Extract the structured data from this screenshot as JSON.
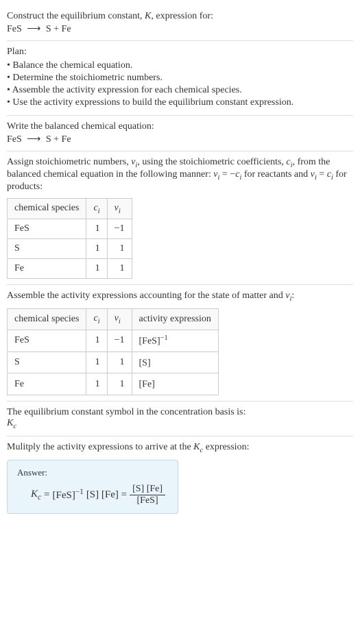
{
  "intro": {
    "prompt": "Construct the equilibrium constant, ",
    "k_symbol": "K",
    "prompt_suffix": ", expression for:",
    "equation_left": "FeS",
    "arrow": "⟶",
    "equation_right": "S + Fe"
  },
  "plan": {
    "label": "Plan:",
    "items": [
      "Balance the chemical equation.",
      "Determine the stoichiometric numbers.",
      "Assemble the activity expression for each chemical species.",
      "Use the activity expressions to build the equilibrium constant expression."
    ]
  },
  "balanced": {
    "text": "Write the balanced chemical equation:",
    "equation_left": "FeS",
    "arrow": "⟶",
    "equation_right": "S + Fe"
  },
  "stoich": {
    "text1": "Assign stoichiometric numbers, ",
    "nu": "ν",
    "sub_i": "i",
    "text2": ", using the stoichiometric coefficients, ",
    "c": "c",
    "text3": ", from the balanced chemical equation in the following manner: ",
    "eq1_left": "ν",
    "eq1_mid": " = −",
    "eq1_right": "c",
    "text4": " for reactants and ",
    "eq2_left": "ν",
    "eq2_mid": " = ",
    "eq2_right": "c",
    "text5": " for products:",
    "table": {
      "headers": [
        "chemical species",
        "c",
        "ν"
      ],
      "sub": "i",
      "rows": [
        {
          "species": "FeS",
          "c": "1",
          "nu": "−1"
        },
        {
          "species": "S",
          "c": "1",
          "nu": "1"
        },
        {
          "species": "Fe",
          "c": "1",
          "nu": "1"
        }
      ]
    }
  },
  "activity": {
    "text1": "Assemble the activity expressions accounting for the state of matter and ",
    "nu": "ν",
    "sub_i": "i",
    "colon": ":",
    "table": {
      "headers": [
        "chemical species",
        "c",
        "ν",
        "activity expression"
      ],
      "sub": "i",
      "rows": [
        {
          "species": "FeS",
          "c": "1",
          "nu": "−1",
          "expr_base": "[FeS]",
          "expr_sup": "−1"
        },
        {
          "species": "S",
          "c": "1",
          "nu": "1",
          "expr_base": "[S]",
          "expr_sup": ""
        },
        {
          "species": "Fe",
          "c": "1",
          "nu": "1",
          "expr_base": "[Fe]",
          "expr_sup": ""
        }
      ]
    }
  },
  "basis": {
    "text": "The equilibrium constant symbol in the concentration basis is:",
    "symbol": "K",
    "sub": "c"
  },
  "multiply": {
    "text1": "Mulitply the activity expressions to arrive at the ",
    "k": "K",
    "sub": "c",
    "text2": " expression:"
  },
  "answer": {
    "label": "Answer:",
    "kc": "K",
    "kc_sub": "c",
    "eq": " = ",
    "term1_base": "[FeS]",
    "term1_sup": "−1",
    "term2": " [S] [Fe] = ",
    "frac_top": "[S] [Fe]",
    "frac_bot": "[FeS]"
  }
}
